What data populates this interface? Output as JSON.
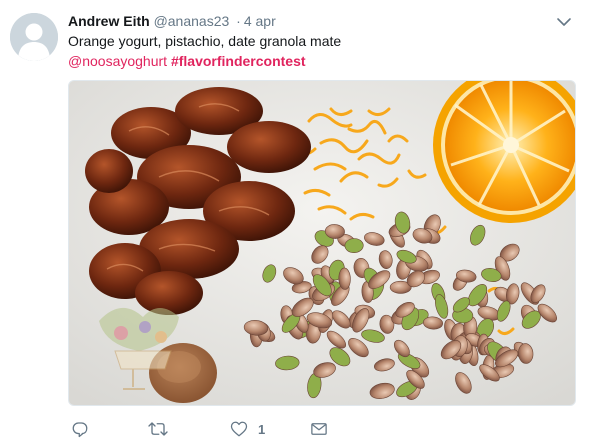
{
  "tweet": {
    "fullname": "Andrew Eith",
    "handle": "@ananas23",
    "separator": "·",
    "time": "4 apr",
    "text_line1": "Orange yogurt, pistachio, date granola mate",
    "mention": "@noosayoghurt",
    "hashtag": "#flavorfindercontest"
  },
  "actions": {
    "reply": {
      "icon": "reply-icon"
    },
    "retweet": {
      "icon": "retweet-icon"
    },
    "like": {
      "icon": "heart-icon",
      "count": "1"
    },
    "dm": {
      "icon": "envelope-icon"
    }
  },
  "colors": {
    "link": "#e0245e",
    "muted": "#657786",
    "text": "#14171a"
  }
}
